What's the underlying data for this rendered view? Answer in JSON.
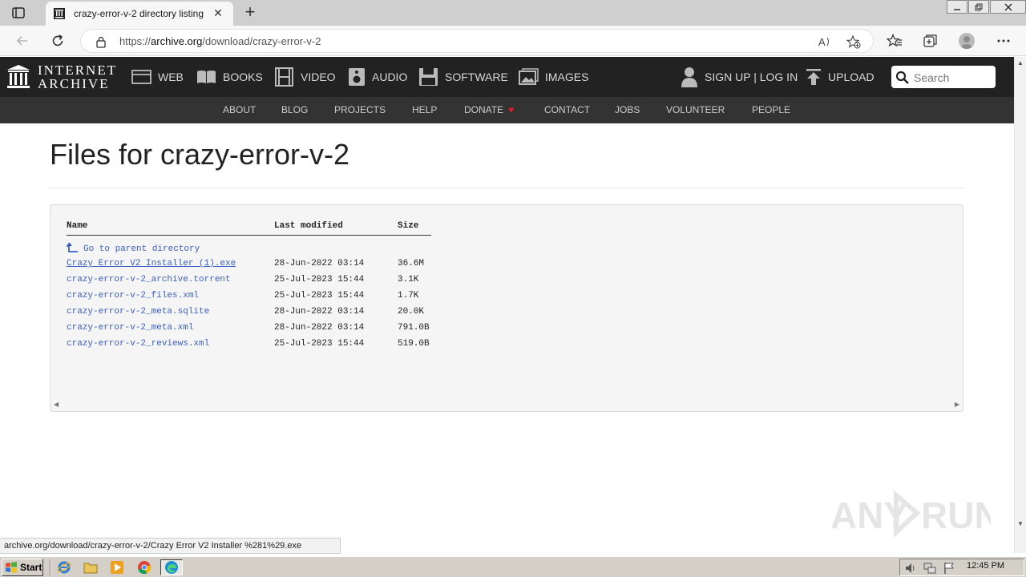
{
  "browser": {
    "tab_title": "crazy-error-v-2 directory listing",
    "tab_close": "✕",
    "new_tab": "+",
    "url_prefix": "https://",
    "url_host": "archive.org",
    "url_path": "/download/crazy-error-v-2",
    "status_text": "archive.org/download/crazy-error-v-2/Crazy Error V2 Installer %281%29.exe"
  },
  "ia_header": {
    "logo_line1": "INTERNET",
    "logo_line2": "ARCHIVE",
    "nav": [
      {
        "label": "WEB",
        "icon": "web-icon"
      },
      {
        "label": "BOOKS",
        "icon": "books-icon"
      },
      {
        "label": "VIDEO",
        "icon": "video-icon"
      },
      {
        "label": "AUDIO",
        "icon": "audio-icon"
      },
      {
        "label": "SOFTWARE",
        "icon": "software-icon"
      },
      {
        "label": "IMAGES",
        "icon": "images-icon"
      }
    ],
    "signin": "SIGN UP | LOG IN",
    "upload": "UPLOAD",
    "search_placeholder": "Search",
    "subnav": [
      "ABOUT",
      "BLOG",
      "PROJECTS",
      "HELP",
      "DONATE",
      "CONTACT",
      "JOBS",
      "VOLUNTEER",
      "PEOPLE"
    ]
  },
  "main": {
    "title": "Files for crazy-error-v-2",
    "columns": [
      "Name",
      "Last modified",
      "Size"
    ],
    "parent_link": "Go to parent directory",
    "files": [
      {
        "name": "Crazy Error V2 Installer (1).exe",
        "modified": "28-Jun-2022 03:14",
        "size": "36.6M"
      },
      {
        "name": "crazy-error-v-2_archive.torrent",
        "modified": "25-Jul-2023 15:44",
        "size": "3.1K"
      },
      {
        "name": "crazy-error-v-2_files.xml",
        "modified": "25-Jul-2023 15:44",
        "size": "1.7K"
      },
      {
        "name": "crazy-error-v-2_meta.sqlite",
        "modified": "28-Jun-2022 03:14",
        "size": "20.0K"
      },
      {
        "name": "crazy-error-v-2_meta.xml",
        "modified": "28-Jun-2022 03:14",
        "size": "791.0B"
      },
      {
        "name": "crazy-error-v-2_reviews.xml",
        "modified": "25-Jul-2023 15:44",
        "size": "519.0B"
      }
    ]
  },
  "taskbar": {
    "start_label": "Start",
    "clock": "12:45 PM"
  },
  "watermark": "ANY RUN",
  "colors": {
    "link": "#3a5fc1",
    "ia_bar": "#222222",
    "ia_subbar": "#333333",
    "heart": "#e0202c"
  }
}
